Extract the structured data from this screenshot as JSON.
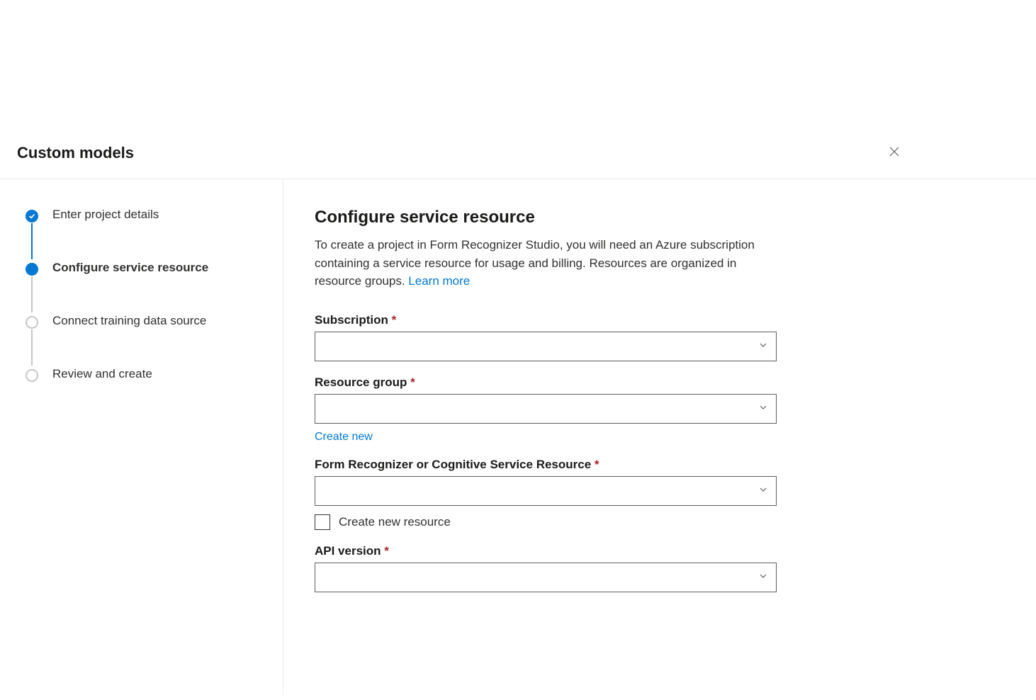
{
  "header": {
    "title": "Custom models"
  },
  "steps": [
    {
      "label": "Enter project details",
      "state": "completed"
    },
    {
      "label": "Configure service resource",
      "state": "current"
    },
    {
      "label": "Connect training data source",
      "state": "pending"
    },
    {
      "label": "Review and create",
      "state": "pending"
    }
  ],
  "main": {
    "title": "Configure service resource",
    "description": "To create a project in Form Recognizer Studio, you will need an Azure subscription containing a service resource for usage and billing. Resources are organized in resource groups. ",
    "learn_more": "Learn more",
    "fields": {
      "subscription": {
        "label": "Subscription",
        "required": true,
        "value": ""
      },
      "resource_group": {
        "label": "Resource group",
        "required": true,
        "value": "",
        "create_new": "Create new"
      },
      "resource": {
        "label": "Form Recognizer or Cognitive Service Resource",
        "required": true,
        "value": "",
        "create_new_checkbox": "Create new resource"
      },
      "api_version": {
        "label": "API version",
        "required": true,
        "value": ""
      }
    }
  }
}
